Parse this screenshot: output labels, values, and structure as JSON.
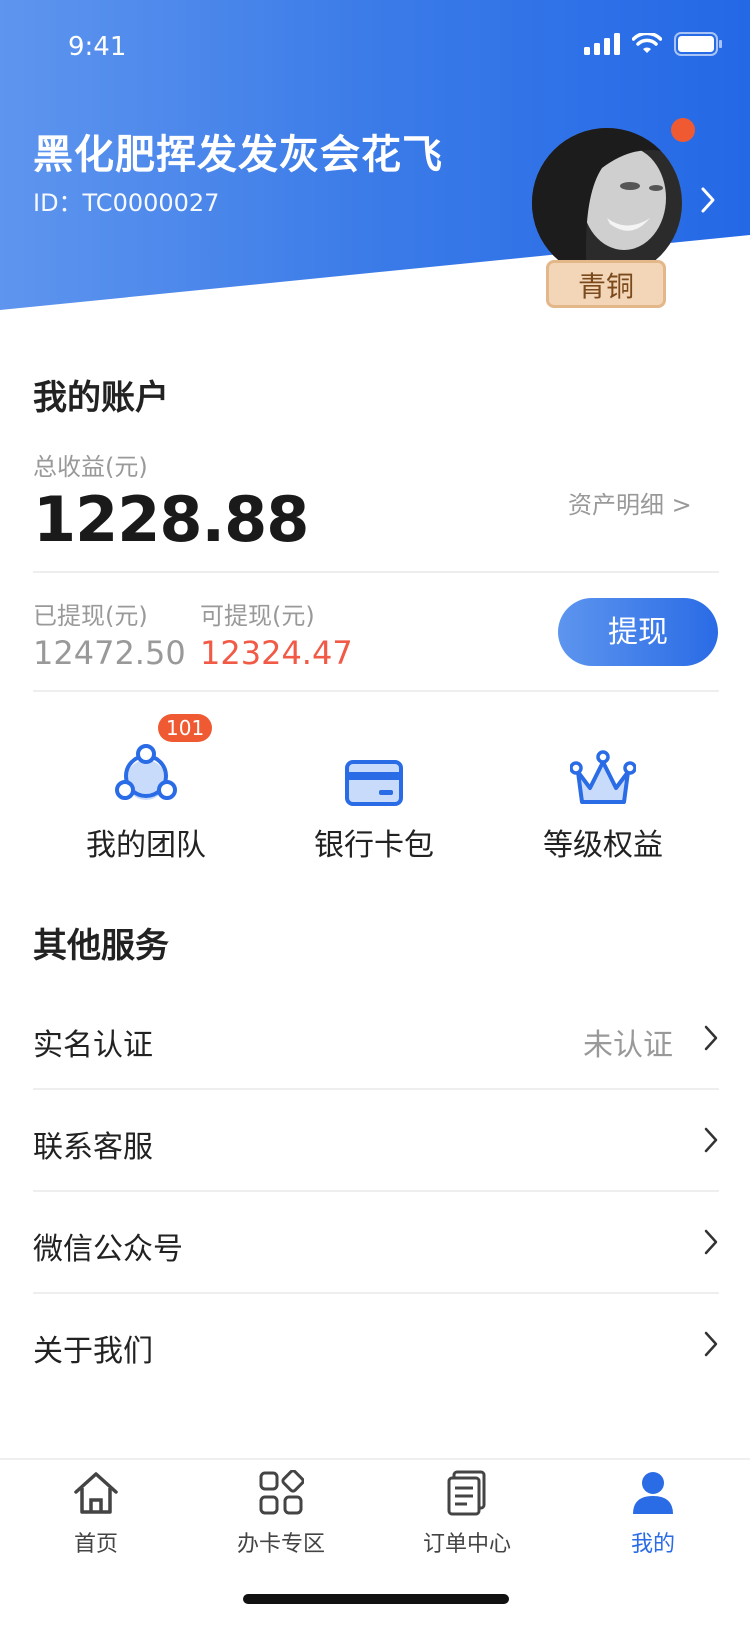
{
  "status_bar": {
    "time": "9:41"
  },
  "profile": {
    "username": "黑化肥挥发发灰会花飞",
    "id_text": "ID：TC0000027",
    "level": "青铜"
  },
  "account": {
    "title": "我的账户",
    "total_label": "总收益(元)",
    "total_value": "1228.88",
    "asset_link": "资产明细 >",
    "withdrawn_label": "已提现(元)",
    "withdrawn_value": "12472.50",
    "available_label": "可提现(元)",
    "available_value": "12324.47",
    "withdraw_button": "提现"
  },
  "features": [
    {
      "label": "我的团队",
      "icon": "team-icon",
      "badge": "101"
    },
    {
      "label": "银行卡包",
      "icon": "bank-card-icon"
    },
    {
      "label": "等级权益",
      "icon": "crown-icon"
    }
  ],
  "services": {
    "title": "其他服务",
    "items": [
      {
        "label": "实名认证",
        "value": "未认证"
      },
      {
        "label": "联系客服",
        "value": ""
      },
      {
        "label": "微信公众号",
        "value": ""
      },
      {
        "label": "关于我们",
        "value": ""
      }
    ]
  },
  "tabbar": {
    "items": [
      {
        "label": "首页",
        "icon": "home-icon",
        "active": false
      },
      {
        "label": "办卡专区",
        "icon": "grid-icon",
        "active": false
      },
      {
        "label": "订单中心",
        "icon": "orders-icon",
        "active": false
      },
      {
        "label": "我的",
        "icon": "user-icon",
        "active": true
      }
    ]
  },
  "colors": {
    "primary": "#2a6be6",
    "accent_red": "#f05a46",
    "level_bg": "#f3d6b8"
  }
}
